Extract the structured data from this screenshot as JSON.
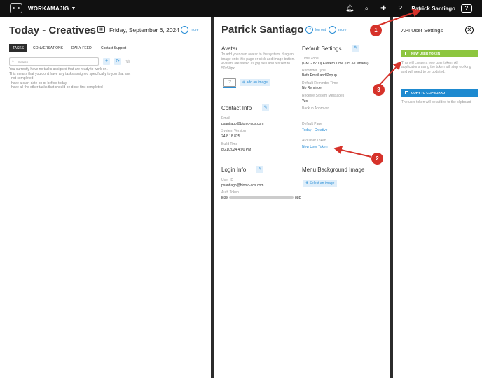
{
  "topbar": {
    "app_name": "WORKAMAJIG",
    "user_name": "Patrick Santiago",
    "help_label": "?",
    "question_glyph": "?"
  },
  "left": {
    "title": "Today - Creatives",
    "date": "Friday, September 6, 2024",
    "more": "more",
    "tabs": [
      "TASKS",
      "CONVERSATIONS",
      "DAILY FEED"
    ],
    "contact_support": "Contact Support",
    "search_placeholder": "Search",
    "info_lines": [
      "You currently have no tasks assigned that are ready to work on.",
      "This means that you don't have any tasks assigned specifically to you that are:",
      "- not completed",
      "- have a start date on or before today",
      "- have all the other tasks that should be done first completed"
    ]
  },
  "profile": {
    "name": "Patrick Santiago",
    "logout": "log out",
    "more": "more",
    "avatar": {
      "title": "Avatar",
      "desc": "To add your own avatar to the system, drag an image onto this page or click add image button. Avatars are saved as jpg files and resized to 50x50px",
      "placeholder": "?",
      "add_button": "add an image"
    },
    "contact": {
      "title": "Contact Info",
      "email_label": "Email",
      "email": "psantiago@bionic-ads.com",
      "version_label": "System Version",
      "version": "24.8.18.825",
      "build_label": "Build Time",
      "build": "8/21/2024 4:00 PM"
    },
    "login": {
      "title": "Login Info",
      "userid_label": "User ID",
      "userid": "psantiago@bionic-ads.com",
      "token_label": "Auth Token",
      "token_start": "E89",
      "token_end": "88D"
    },
    "defaults": {
      "title": "Default Settings",
      "timezone_label": "Time Zone",
      "timezone": "(GMT-05:00) Eastern Time (US & Canada)",
      "reminder_type_label": "Reminder Type",
      "reminder_type": "Both Email and Popup",
      "reminder_time_label": "Default Reminder Time",
      "reminder_time": "No Reminder",
      "receive_label": "Receive System Messages",
      "receive": "Yes",
      "backup_label": "Backup Approver",
      "default_page_label": "Default Page",
      "default_page": "Today - Creative",
      "api_label": "API User Token",
      "api_link": "New User Token"
    },
    "menu_bg": {
      "title": "Menu Background Image",
      "select_button": "Select an image"
    }
  },
  "api_panel": {
    "title": "API User Settings",
    "new_token_button": "NEW USER TOKEN",
    "new_token_desc": "This will create a new user token. All applications using the token will stop working and will need to be updated.",
    "copy_button": "COPY TO CLIPBOARD",
    "copy_desc": "The user token will be added to the clipboard"
  },
  "callouts": [
    "1",
    "2",
    "3"
  ],
  "colors": {
    "accent": "#2b8fd6",
    "green": "#8dc63f",
    "callout": "#d6322a",
    "topbar": "#111111"
  }
}
